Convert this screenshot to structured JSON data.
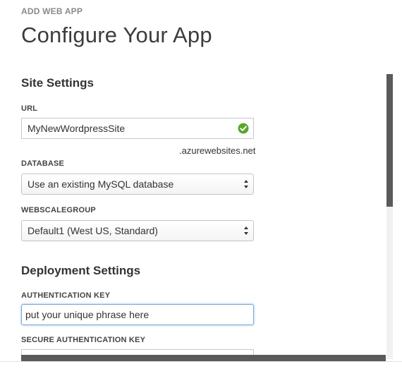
{
  "header": {
    "kicker": "ADD WEB APP",
    "title": "Configure Your App"
  },
  "site_settings": {
    "title": "Site Settings",
    "url": {
      "label": "URL",
      "value": "MyNewWordpressSite",
      "suffix": ".azurewebsites.net",
      "status_icon": "check-circle-icon",
      "status_color": "#5aa62a"
    },
    "database": {
      "label": "DATABASE",
      "selected": "Use an existing MySQL database"
    },
    "webscalegroup": {
      "label": "WEBSCALEGROUP",
      "selected": "Default1 (West US, Standard)"
    }
  },
  "deployment_settings": {
    "title": "Deployment Settings",
    "auth_key": {
      "label": "AUTHENTICATION KEY",
      "value": "put your unique phrase here"
    },
    "secure_auth_key": {
      "label": "SECURE AUTHENTICATION KEY",
      "value": ""
    }
  },
  "colors": {
    "focus_border": "#7aa6d6",
    "scrollbar": "#5a5a5a"
  }
}
